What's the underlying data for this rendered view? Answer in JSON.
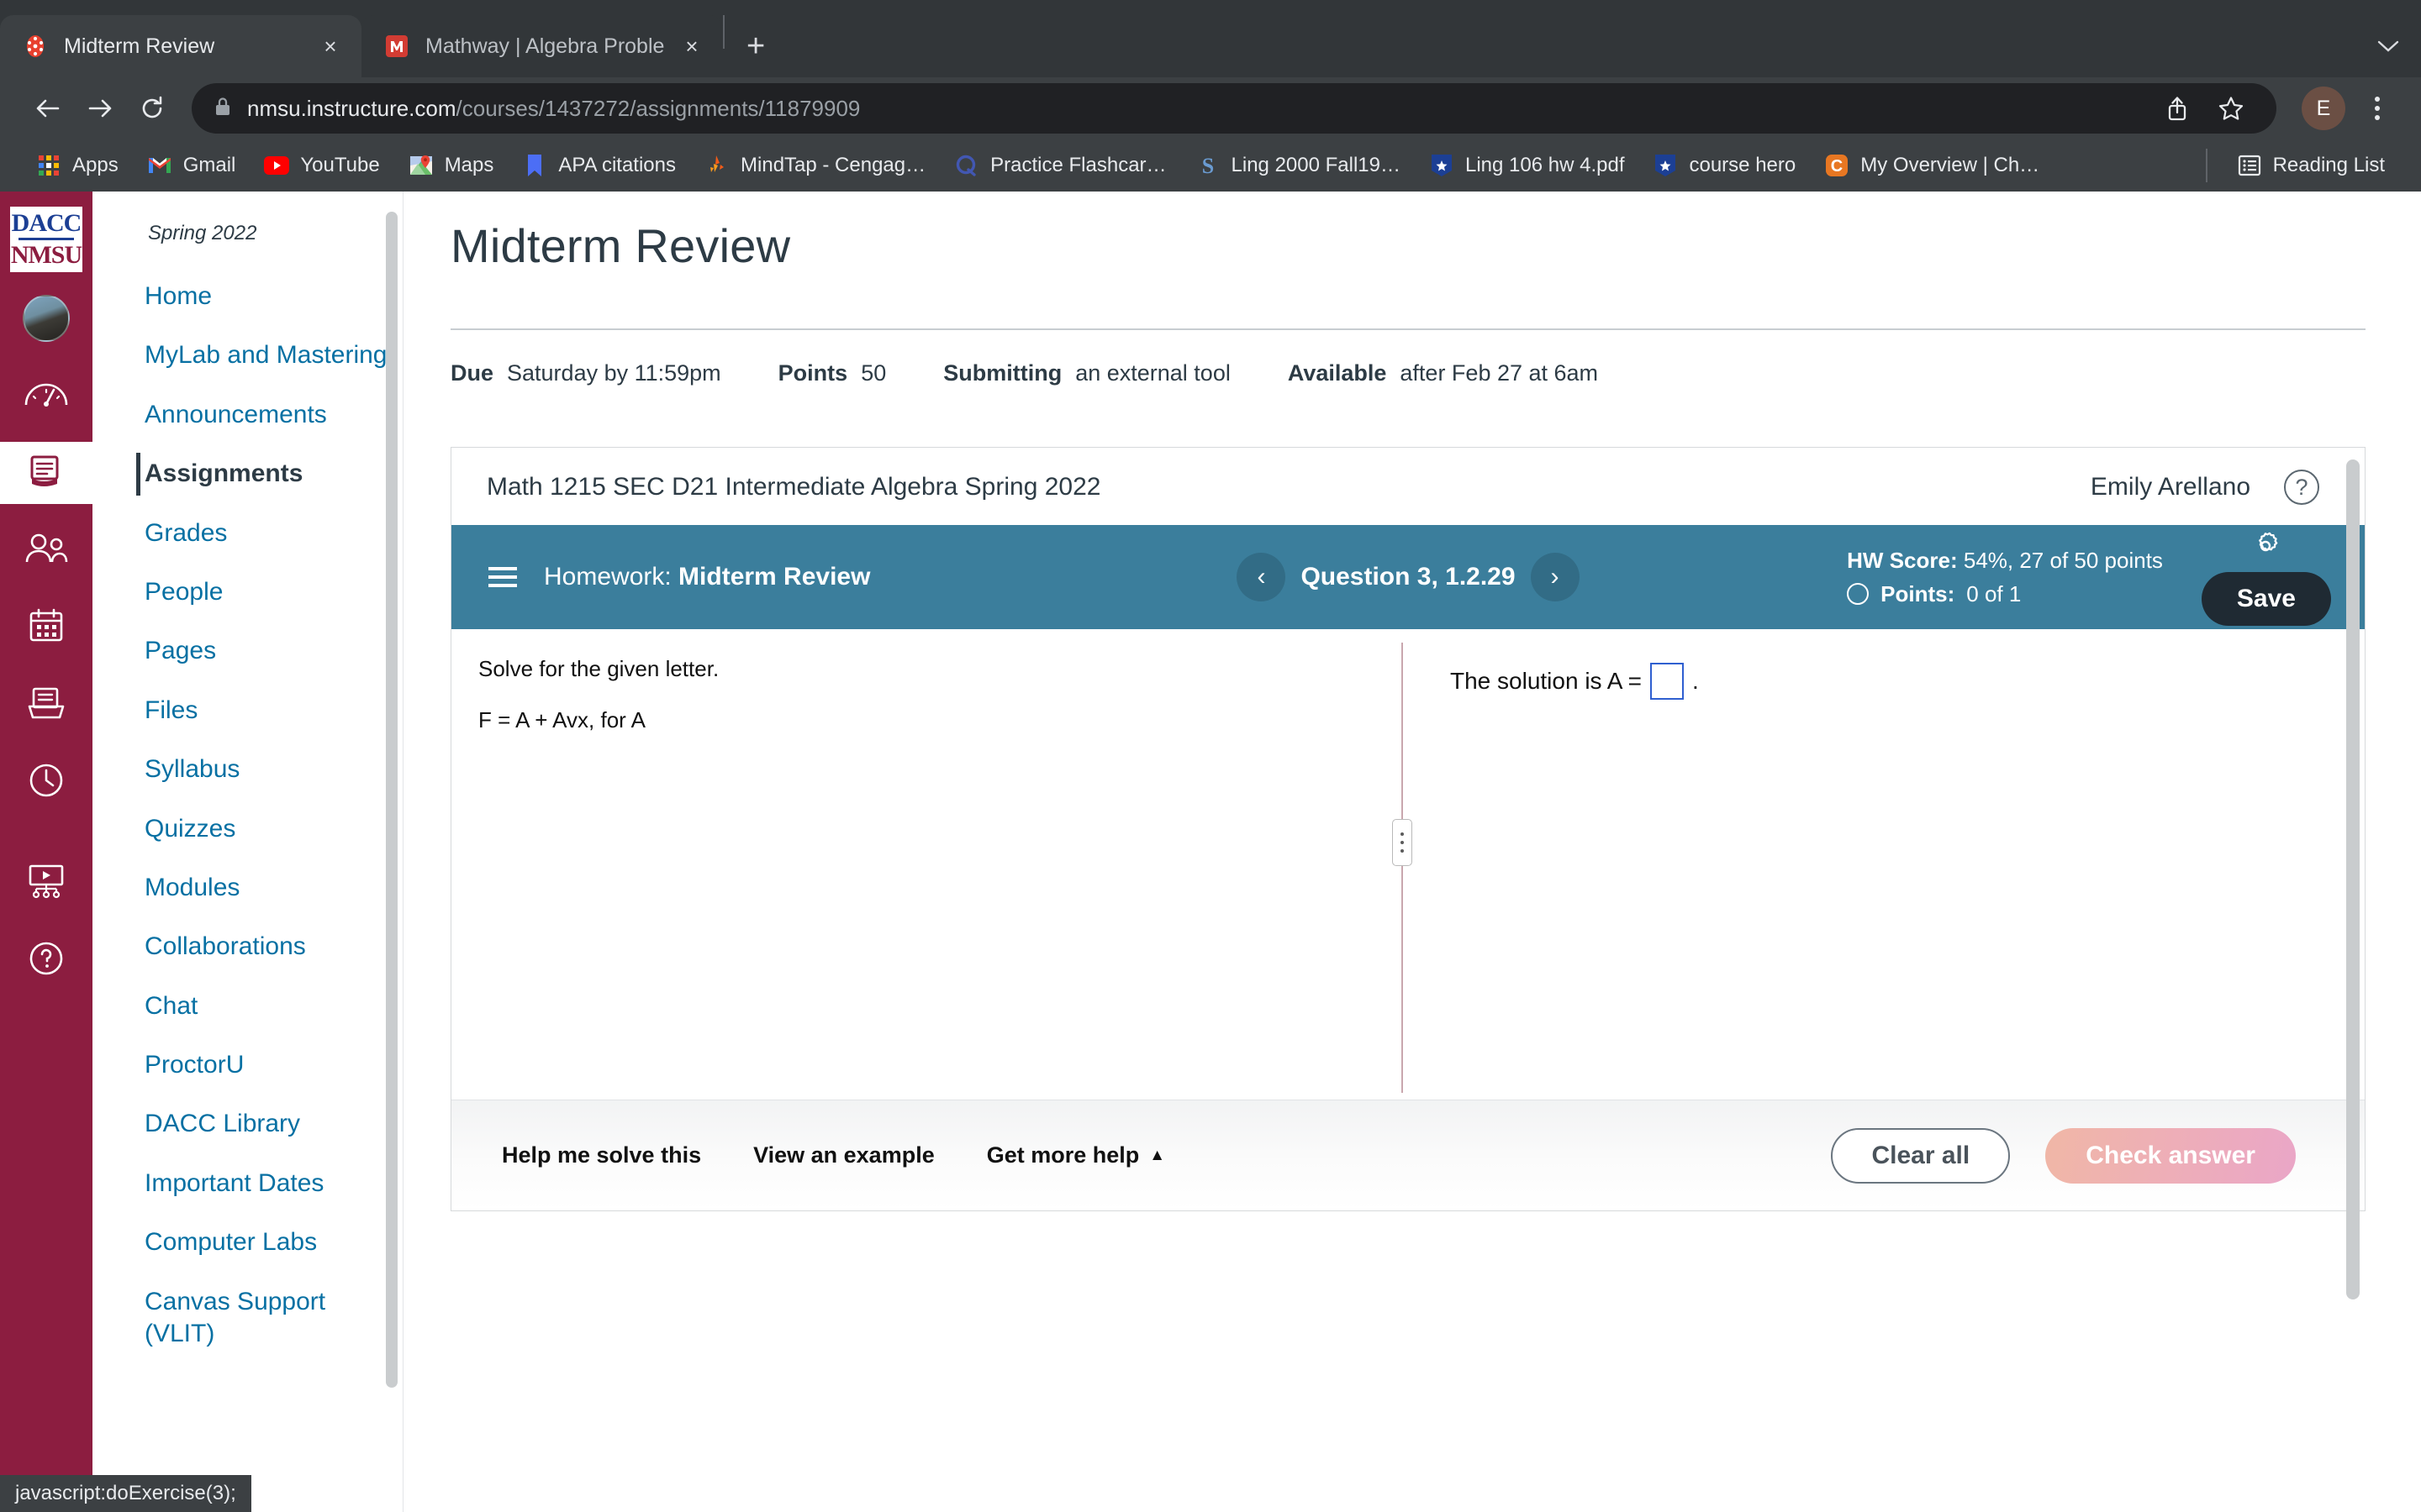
{
  "browser": {
    "tabs": [
      {
        "title": "Midterm Review",
        "favicon": "canvas-icon",
        "active": true,
        "close_label": "×"
      },
      {
        "title": "Mathway | Algebra Problem Sol",
        "favicon": "mathway-icon",
        "active": false,
        "close_label": "×"
      }
    ],
    "new_tab_label": "+",
    "tab_list_chevron": "⌄",
    "nav": {
      "back": "back-arrow",
      "forward": "forward-arrow",
      "reload": "reload-arrow"
    },
    "omnibox": {
      "lock": "lock-icon",
      "url_host": "nmsu.instructure.com",
      "url_path": "/courses/1437272/assignments/11879909"
    },
    "profile_initial": "E",
    "bookmarks": [
      {
        "label": "Apps",
        "icon": "apps-grid-icon"
      },
      {
        "label": "Gmail",
        "icon": "gmail-icon"
      },
      {
        "label": "YouTube",
        "icon": "youtube-icon"
      },
      {
        "label": "Maps",
        "icon": "maps-icon"
      },
      {
        "label": "APA citations",
        "icon": "bookmark-blue-icon"
      },
      {
        "label": "MindTap - Cengag…",
        "icon": "mindtap-icon"
      },
      {
        "label": "Practice Flashcar…",
        "icon": "quizlet-icon"
      },
      {
        "label": "Ling 2000 Fall19…",
        "icon": "scribd-icon"
      },
      {
        "label": "Ling 106 hw 4.pdf",
        "icon": "star-shield-icon"
      },
      {
        "label": "course hero",
        "icon": "star-shield-icon"
      },
      {
        "label": "My Overview | Ch…",
        "icon": "chegg-icon"
      }
    ],
    "reading_list": {
      "label": "Reading List",
      "icon": "reading-list-icon"
    },
    "status_text": "javascript:doExercise(3);"
  },
  "canvas": {
    "global_nav": [
      {
        "name": "account",
        "icon": "avatar-icon"
      },
      {
        "name": "dashboard",
        "icon": "dashboard-speedometer-icon"
      },
      {
        "name": "courses",
        "icon": "courses-book-icon",
        "active": true
      },
      {
        "name": "groups",
        "icon": "groups-people-icon"
      },
      {
        "name": "calendar",
        "icon": "calendar-icon"
      },
      {
        "name": "inbox",
        "icon": "inbox-tray-icon"
      },
      {
        "name": "history",
        "icon": "clock-icon"
      },
      {
        "name": "studio",
        "icon": "studio-screen-icon"
      },
      {
        "name": "help",
        "icon": "help-question-icon"
      }
    ],
    "logo": {
      "line1": "DACC",
      "line2": "NMSU"
    },
    "collapse_icon": "collapse-arrow-icon",
    "course_nav": {
      "term": "Spring 2022",
      "items": [
        {
          "label": "Home",
          "active": false
        },
        {
          "label": "MyLab and Mastering",
          "active": false
        },
        {
          "label": "Announcements",
          "active": false
        },
        {
          "label": "Assignments",
          "active": true
        },
        {
          "label": "Grades",
          "active": false
        },
        {
          "label": "People",
          "active": false
        },
        {
          "label": "Pages",
          "active": false
        },
        {
          "label": "Files",
          "active": false
        },
        {
          "label": "Syllabus",
          "active": false
        },
        {
          "label": "Quizzes",
          "active": false
        },
        {
          "label": "Modules",
          "active": false
        },
        {
          "label": "Collaborations",
          "active": false
        },
        {
          "label": "Chat",
          "active": false
        },
        {
          "label": "ProctorU",
          "active": false
        },
        {
          "label": "DACC Library",
          "active": false
        },
        {
          "label": "Important Dates",
          "active": false
        },
        {
          "label": "Computer Labs",
          "active": false
        },
        {
          "label": "Canvas Support (VLIT)",
          "active": false
        }
      ]
    },
    "assignment": {
      "title": "Midterm Review",
      "meta": [
        {
          "key": "Due",
          "value": "Saturday by 11:59pm"
        },
        {
          "key": "Points",
          "value": "50"
        },
        {
          "key": "Submitting",
          "value": "an external tool"
        },
        {
          "key": "Available",
          "value": "after Feb 27 at 6am"
        }
      ]
    }
  },
  "mylab": {
    "course_title": "Math 1215 SEC D21 Intermediate Algebra Spring 2022",
    "user_name": "Emily Arellano",
    "help_icon": "question-circle-icon",
    "toolbar": {
      "menu_icon": "hamburger-menu-icon",
      "hw_prefix": "Homework:",
      "hw_name": "Midterm Review",
      "prev_icon": "‹",
      "question_label": "Question 3, 1.2.29",
      "next_icon": "›",
      "hw_score_key": "HW Score:",
      "hw_score_value": "54%, 27 of 50 points",
      "points_key": "Points:",
      "points_value": "0 of 1",
      "points_status_icon": "empty-circle-icon",
      "settings_icon": "gear-icon",
      "save_label": "Save"
    },
    "question": {
      "prompt": "Solve for the given letter.",
      "equation": "F = A + Avx, for A",
      "answer_prefix": "The solution is A =",
      "answer_value": "",
      "answer_suffix": ".",
      "splitter_icon": "drag-handle-icon"
    },
    "footer": {
      "links": [
        {
          "label": "Help me solve this",
          "caret": ""
        },
        {
          "label": "View an example",
          "caret": ""
        },
        {
          "label": "Get more help",
          "caret": "▲"
        }
      ],
      "clear_label": "Clear all",
      "check_label": "Check answer"
    },
    "accent_color": "#3b7e9c",
    "save_color": "#1f2a33"
  }
}
